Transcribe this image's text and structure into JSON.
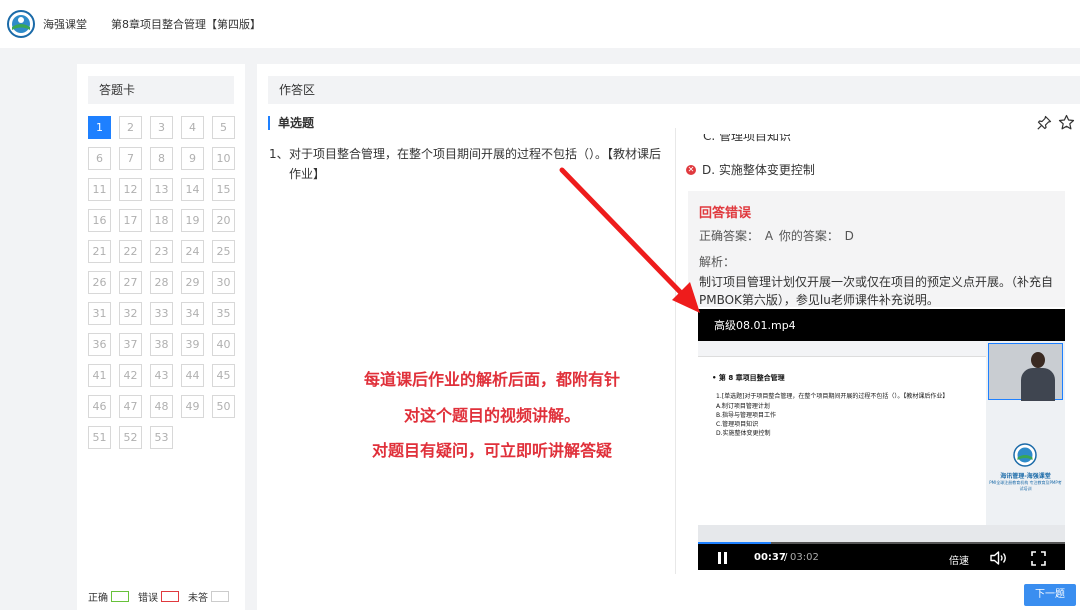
{
  "header": {
    "brand": "海强课堂",
    "chapter": "第8章项目整合管理【第四版】"
  },
  "answer_card": {
    "title": "答题卡",
    "numbers": [
      "1",
      "2",
      "3",
      "4",
      "5",
      "6",
      "7",
      "8",
      "9",
      "10",
      "11",
      "12",
      "13",
      "14",
      "15",
      "16",
      "17",
      "18",
      "19",
      "20",
      "21",
      "22",
      "23",
      "24",
      "25",
      "26",
      "27",
      "28",
      "29",
      "30",
      "31",
      "32",
      "33",
      "34",
      "35",
      "36",
      "37",
      "38",
      "39",
      "40",
      "41",
      "42",
      "43",
      "44",
      "45",
      "46",
      "47",
      "48",
      "49",
      "50",
      "51",
      "52",
      "53"
    ],
    "active_index": 0,
    "legend": {
      "correct": "正确",
      "wrong": "错误",
      "unanswered": "未答"
    }
  },
  "work": {
    "title": "作答区",
    "question_type": "单选题",
    "question_number": "1、",
    "question_text": "对于项目整合管理，在整个项目期间开展的过程不包括（）。【教材课后作业】",
    "partial_option_c": "C. 管理项目知识",
    "option_d": "D. 实施整体变更控制",
    "result_title": "回答错误",
    "answers": "正确答案：  A    你的答案：  D",
    "analysis_label": "解析：",
    "analysis_text": "制订项目管理计划仅开展一次或仅在项目的预定义点开展。（补充自PMBOK第六版），参见lu老师课件补充说明。",
    "next_button": "下一题"
  },
  "video": {
    "title": "高级08.01.mp4",
    "doc_heading": "• 第 8 章项目整合管理",
    "doc_question": "1.[单选题]对于项目整合管理，在整个项目期间开展的过程不包括（）。【教材课后作业】",
    "doc_options": [
      "A.制订项目管理计划",
      "B.指导与管理项目工作",
      "C.管理项目知识",
      "D.实施整体变更控制"
    ],
    "side_text": "海讯管理-海强课堂",
    "side_subtext": "PMI全球注册教育机构 专注教育及PMP考试培训",
    "current_time": "00:37",
    "separator": "/",
    "total_time": "03:02",
    "progress": 0.2,
    "speed_label": "倍速"
  },
  "annotation": {
    "lines": [
      "每道课后作业的解析后面，都附有针",
      "对这个题目的视频讲解。",
      "对题目有疑问，可立即听讲解答疑"
    ]
  },
  "colors": {
    "accent": "#1e80ff",
    "error": "#e0393e",
    "annotation": "#e0303a"
  }
}
